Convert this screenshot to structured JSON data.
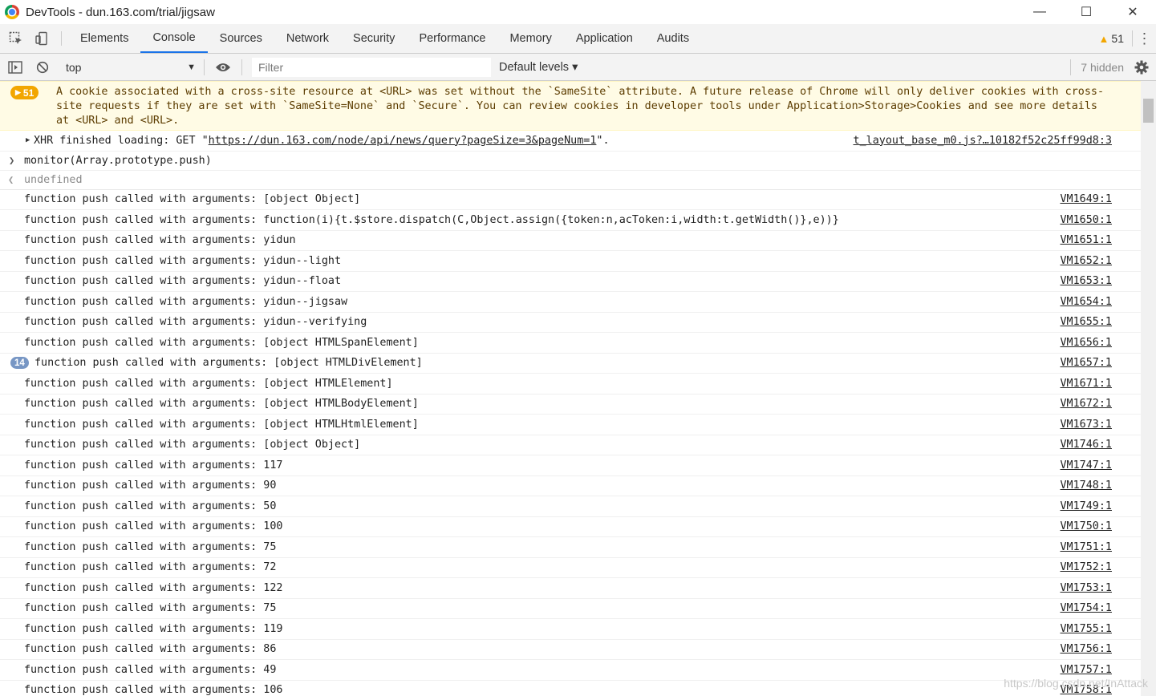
{
  "window": {
    "title": "DevTools - dun.163.com/trial/jigsaw",
    "minimize": "—",
    "maximize": "☐",
    "close": "✕"
  },
  "tabs": [
    "Elements",
    "Console",
    "Sources",
    "Network",
    "Security",
    "Performance",
    "Memory",
    "Application",
    "Audits"
  ],
  "active_tab": "Console",
  "header_right": {
    "warning_count": "51",
    "menu": "⋮"
  },
  "toolbar": {
    "context": "top",
    "filter_placeholder": "Filter",
    "levels": "Default levels ▾",
    "hidden": "7 hidden"
  },
  "warning": {
    "badge": "51",
    "text": "A cookie associated with a cross-site resource at <URL> was set without the `SameSite` attribute. A future release of Chrome will only deliver cookies with cross-site requests if they are set with `SameSite=None` and `Secure`. You can review cookies in developer tools under Application>Storage>Cookies and see more details at <URL> and <URL>."
  },
  "xhr": {
    "prefix": "XHR finished loading: GET \"",
    "url": "https://dun.163.com/node/api/news/query?pageSize=3&pageNum=1",
    "suffix": "\".",
    "source": "t_layout_base_m0.js?…10182f52c25ff99d8:3"
  },
  "command": "monitor(Array.prototype.push)",
  "result": "undefined",
  "log_prefix": "function push called with arguments: ",
  "logs": [
    {
      "arg": "[object Object]",
      "src": "VM1649:1"
    },
    {
      "arg": "function(i){t.$store.dispatch(C,Object.assign({token:n,acToken:i,width:t.getWidth()},e))}",
      "src": "VM1650:1"
    },
    {
      "arg": "yidun",
      "src": "VM1651:1"
    },
    {
      "arg": "yidun--light",
      "src": "VM1652:1"
    },
    {
      "arg": "yidun--float",
      "src": "VM1653:1"
    },
    {
      "arg": "yidun--jigsaw",
      "src": "VM1654:1"
    },
    {
      "arg": "yidun--verifying",
      "src": "VM1655:1"
    },
    {
      "arg": "[object HTMLSpanElement]",
      "src": "VM1656:1"
    },
    {
      "arg": "[object HTMLDivElement]",
      "src": "VM1657:1",
      "badge": "14"
    },
    {
      "arg": "[object HTMLElement]",
      "src": "VM1671:1"
    },
    {
      "arg": "[object HTMLBodyElement]",
      "src": "VM1672:1"
    },
    {
      "arg": "[object HTMLHtmlElement]",
      "src": "VM1673:1"
    },
    {
      "arg": "[object Object]",
      "src": "VM1746:1"
    },
    {
      "arg": "117",
      "src": "VM1747:1"
    },
    {
      "arg": "90",
      "src": "VM1748:1"
    },
    {
      "arg": "50",
      "src": "VM1749:1"
    },
    {
      "arg": "100",
      "src": "VM1750:1"
    },
    {
      "arg": "75",
      "src": "VM1751:1"
    },
    {
      "arg": "72",
      "src": "VM1752:1"
    },
    {
      "arg": "122",
      "src": "VM1753:1"
    },
    {
      "arg": "75",
      "src": "VM1754:1"
    },
    {
      "arg": "119",
      "src": "VM1755:1"
    },
    {
      "arg": "86",
      "src": "VM1756:1"
    },
    {
      "arg": "49",
      "src": "VM1757:1"
    },
    {
      "arg": "106",
      "src": "VM1758:1"
    }
  ],
  "watermark": "https://blog.csdn.net/InAttack"
}
